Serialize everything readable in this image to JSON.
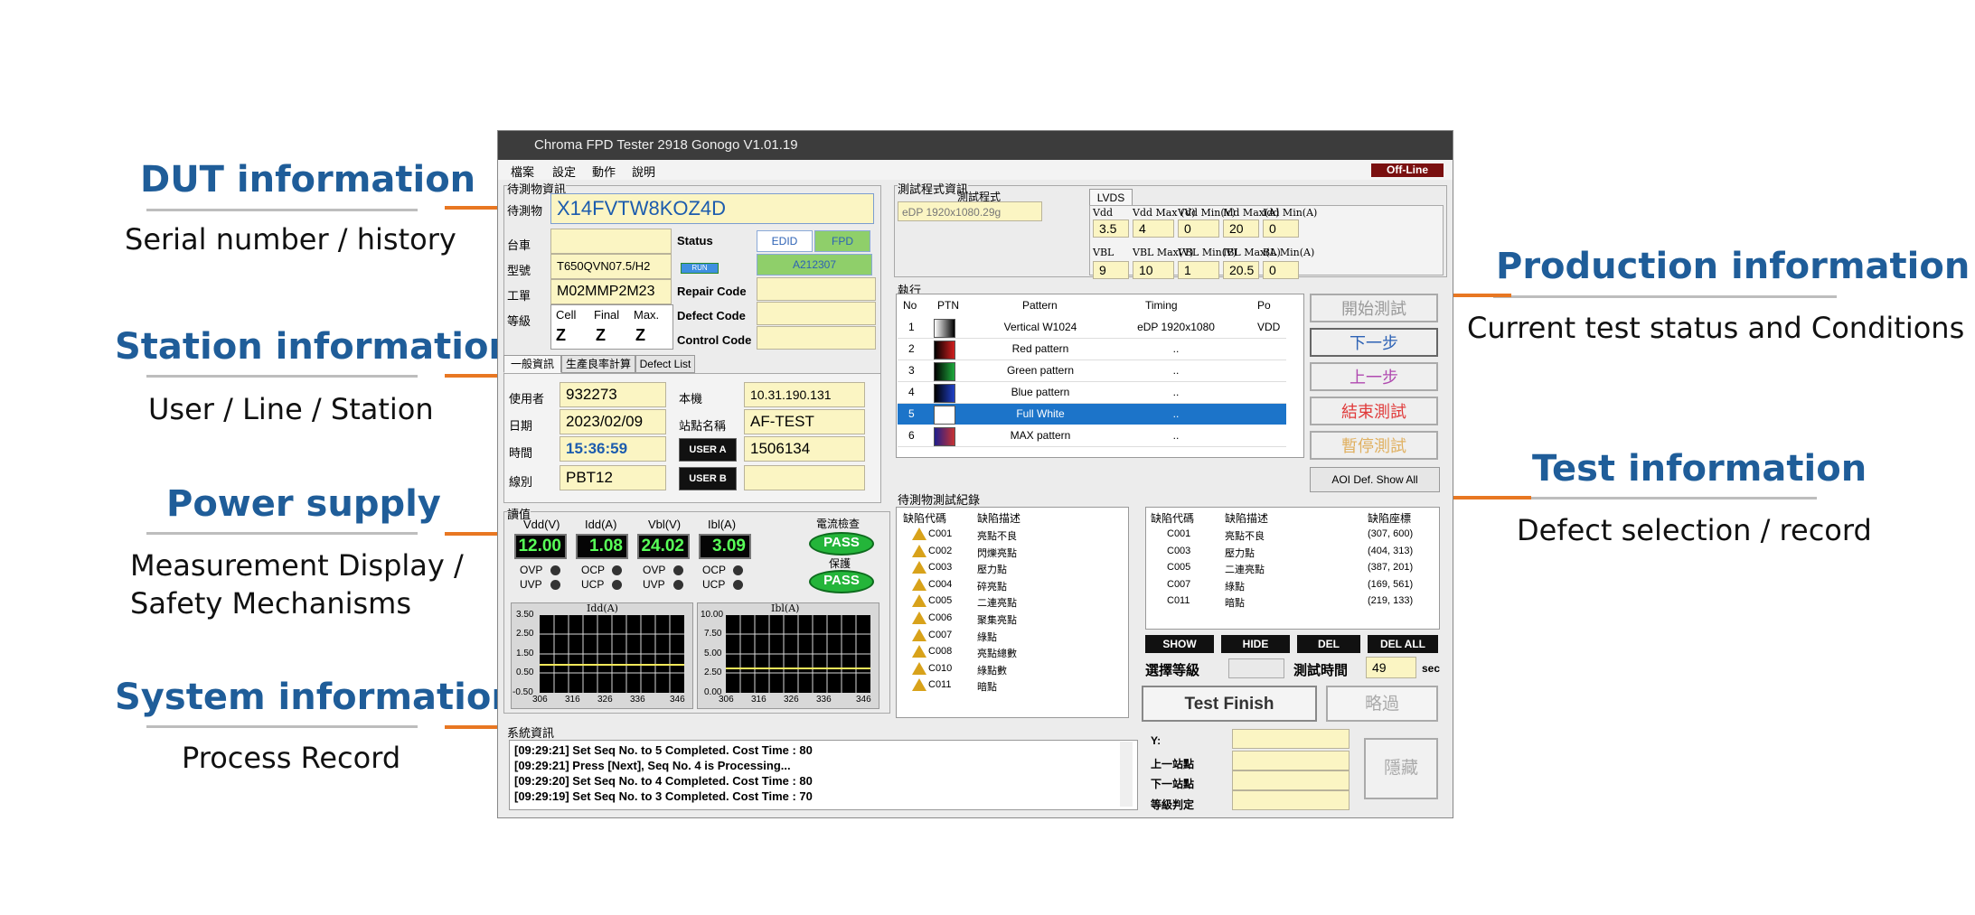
{
  "annotations": {
    "dut": {
      "title": "DUT information",
      "subtitle": "Serial number / history"
    },
    "station": {
      "title": "Station information",
      "subtitle": "User / Line / Station"
    },
    "power": {
      "title": "Power supply",
      "subtitle1": "Measurement Display /",
      "subtitle2": "Safety Mechanisms"
    },
    "system": {
      "title": "System information",
      "subtitle": "Process Record"
    },
    "production": {
      "title": "Production information",
      "subtitle": "Current test status and Conditions"
    },
    "test": {
      "title": "Test information",
      "subtitle": "Defect selection / record"
    }
  },
  "window": {
    "title": "Chroma FPD Tester 2918 Gonogo V1.01.19",
    "status": "Off-Line"
  },
  "menu": [
    "檔案",
    "設定",
    "動作",
    "說明"
  ],
  "dut": {
    "group_label": "待測物資訊",
    "serial_label": "待測物",
    "serial": "X14FVTW8KOZ4D",
    "cart_label": "台車",
    "cart": "",
    "model_label": "型號",
    "model": "T650QVN07.5/H2",
    "workorder_label": "工單",
    "workorder": "M02MMP2M23",
    "grade_label": "等級",
    "grade_headers": [
      "Cell",
      "Final",
      "Max."
    ],
    "grade_values": [
      "Z",
      "Z",
      "Z"
    ],
    "status_label": "Status",
    "edid_btn": "EDID",
    "fpd_btn": "FPD",
    "code_btn": "A212307",
    "run_badge": "RUN",
    "repair_label": "Repair Code",
    "defect_label": "Defect Code",
    "control_label": "Control Code"
  },
  "station": {
    "tabs": [
      "一般資訊",
      "生產良率計算",
      "Defect List"
    ],
    "user_label": "使用者",
    "user": "932273",
    "host_label": "本機",
    "host": "10.31.190.131",
    "date_label": "日期",
    "date": "2023/02/09",
    "station_name_label": "站點名稱",
    "station_name": "AF-TEST",
    "time_label": "時間",
    "time": "15:36:59",
    "user_a_btn": "USER A",
    "user_a_value": "1506134",
    "line_label": "線別",
    "line": "PBT12",
    "user_b_btn": "USER B",
    "user_b_value": ""
  },
  "power": {
    "group_label": "讀值",
    "meters": [
      {
        "label": "Vdd(V)",
        "value": "12.00",
        "p1": "OVP",
        "p2": "UVP"
      },
      {
        "label": "Idd(A)",
        "value": "1.08",
        "p1": "OCP",
        "p2": "UCP"
      },
      {
        "label": "Vbl(V)",
        "value": "24.02",
        "p1": "OVP",
        "p2": "UVP"
      },
      {
        "label": "Ibl(A)",
        "value": "3.09",
        "p1": "OCP",
        "p2": "UCP"
      }
    ],
    "current_check_label": "電流檢查",
    "protect_label": "保護",
    "pass1": "PASS",
    "pass2": "PASS",
    "chart1": {
      "title": "Idd(A)",
      "yticks": [
        "3.50",
        "2.50",
        "1.50",
        "0.50",
        "-0.50"
      ],
      "xticks": [
        "306",
        "316",
        "326",
        "336",
        "346"
      ]
    },
    "chart2": {
      "title": "Ibl(A)",
      "yticks": [
        "10.00",
        "7.50",
        "5.00",
        "2.50",
        "0.00"
      ],
      "xticks": [
        "306",
        "316",
        "326",
        "336",
        "346"
      ]
    }
  },
  "program": {
    "group_label": "測試程式資訊",
    "sub_label": "測試程式",
    "program_value": "eDP 1920x1080.29g",
    "lvds_tab": "LVDS",
    "headers1": [
      "Vdd",
      "Vdd Max (V)",
      "Vdd Min(V)",
      "Idd Max(A)",
      "Idd Min(A)"
    ],
    "values1": [
      "3.5",
      "4",
      "0",
      "20",
      "0"
    ],
    "headers2": [
      "VBL",
      "VBL Max(V)",
      "VBL Min(V)",
      "IBL Max(A)",
      "BL Min(A)"
    ],
    "values2": [
      "9",
      "10",
      "1",
      "20.5",
      "0"
    ]
  },
  "exec": {
    "group_label": "執行",
    "headers": [
      "No",
      "PTN",
      "Pattern",
      "Timing",
      "Po"
    ],
    "rows": [
      {
        "no": "1",
        "pattern": "Vertical W1024",
        "timing": "eDP 1920x1080",
        "po": "VDD"
      },
      {
        "no": "2",
        "pattern": "Red pattern",
        "timing": "..",
        "po": ""
      },
      {
        "no": "3",
        "pattern": "Green pattern",
        "timing": "..",
        "po": ""
      },
      {
        "no": "4",
        "pattern": "Blue pattern",
        "timing": "..",
        "po": ""
      },
      {
        "no": "5",
        "pattern": "Full White",
        "timing": "..",
        "po": ""
      },
      {
        "no": "6",
        "pattern": "MAX pattern",
        "timing": "..",
        "po": ""
      }
    ],
    "side_buttons": [
      "開始測試",
      "下一步",
      "上一步",
      "結束測試",
      "暫停測試"
    ],
    "aoi_button": "AOI Def. Show All"
  },
  "defects": {
    "group_label": "待測物測試紀錄",
    "left_headers": [
      "缺陷代碼",
      "缺陷描述"
    ],
    "left_items": [
      {
        "code": "C001",
        "desc": "亮點不良"
      },
      {
        "code": "C002",
        "desc": "閃爍亮點"
      },
      {
        "code": "C003",
        "desc": "壓力點"
      },
      {
        "code": "C004",
        "desc": "碎亮點"
      },
      {
        "code": "C005",
        "desc": "二連亮點"
      },
      {
        "code": "C006",
        "desc": "聚集亮點"
      },
      {
        "code": "C007",
        "desc": "綠點"
      },
      {
        "code": "C008",
        "desc": "亮點總數"
      },
      {
        "code": "C010",
        "desc": "綠點數"
      },
      {
        "code": "C011",
        "desc": "暗點"
      }
    ],
    "right_headers": [
      "缺陷代碼",
      "缺陷描述",
      "缺陷座標"
    ],
    "right_items": [
      {
        "code": "C001",
        "desc": "亮點不良",
        "coord": "(307, 600)"
      },
      {
        "code": "C003",
        "desc": "壓力點",
        "coord": "(404, 313)"
      },
      {
        "code": "C005",
        "desc": "二連亮點",
        "coord": "(387, 201)"
      },
      {
        "code": "C007",
        "desc": "綠點",
        "coord": "(169, 561)"
      },
      {
        "code": "C011",
        "desc": "暗點",
        "coord": "(219, 133)"
      }
    ],
    "buttons": [
      "SHOW",
      "HIDE",
      "DEL",
      "DEL ALL"
    ],
    "grade_select_label": "選擇等級",
    "test_time_label": "測試時間",
    "test_time": "49",
    "test_time_unit": "sec",
    "finish_btn": "Test Finish",
    "skip_btn": "略過"
  },
  "system": {
    "group_label": "系統資訊",
    "logs": [
      "[09:29:21] Set Seq No. to 5 Completed. Cost Time : 80",
      "[09:29:21] Press [Next], Seq No. 4 is Processing...",
      "[09:29:20] Set Seq No. to 4 Completed. Cost Time : 80",
      "[09:29:19] Set Seq No. to 3 Completed. Cost Time : 70"
    ],
    "y_label": "Y:",
    "prev_station_label": "上一站點",
    "next_station_label": "下一站點",
    "grade_judge_label": "等級判定",
    "hide_btn": "隱藏"
  },
  "colors": {
    "annotation_title": "#1f5d99",
    "leader_line": "#e87722",
    "field_yellow": "#fbf5c3",
    "lcd_green": "#58ff58",
    "pass_green": "#24b53a",
    "selected_row": "#1c74c9"
  }
}
